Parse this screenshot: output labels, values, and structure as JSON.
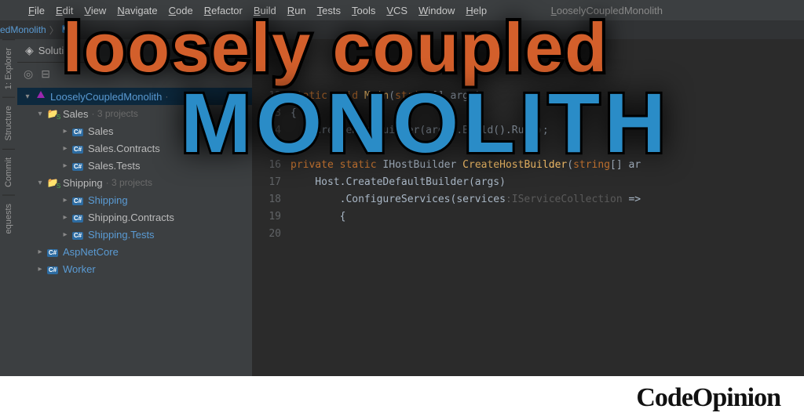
{
  "menubar": {
    "items": [
      "File",
      "Edit",
      "View",
      "Navigate",
      "Code",
      "Refactor",
      "Build",
      "Run",
      "Tests",
      "Tools",
      "VCS",
      "Window",
      "Help"
    ],
    "window_title": "LooselyCoupledMonolith"
  },
  "breadcrumb": {
    "root": "edMonolith",
    "badge": "C#"
  },
  "left_tools": [
    "1: Explorer",
    "Structure",
    "Commit",
    "equests"
  ],
  "explorer": {
    "header": "Soluti",
    "tree": {
      "solution": "LooselyCoupledMonolith",
      "groups": [
        {
          "name": "Sales",
          "meta": "· 3 projects",
          "projects": [
            "Sales",
            "Sales.Contracts",
            "Sales.Tests"
          ],
          "links": [
            false,
            false,
            false
          ]
        },
        {
          "name": "Shipping",
          "meta": "· 3 projects",
          "projects": [
            "Shipping",
            "Shipping.Contracts",
            "Shipping.Tests"
          ],
          "links": [
            true,
            false,
            true
          ]
        }
      ],
      "extra": [
        "AspNetCore",
        "Worker"
      ]
    }
  },
  "editor": {
    "lines_start": 12,
    "lines": [
      {
        "n": 12,
        "html": "<span class='kw'>static</span> <span class='kw'>void</span> <span class='mth'>Main</span>(<span class='kw'>string</span>[] args)"
      },
      {
        "n": 13,
        "html": "{"
      },
      {
        "n": 14,
        "html": "    CreateHostBuilder(args).Build().Run();"
      },
      {
        "n": 15,
        "html": "}"
      },
      {
        "n": 16,
        "html": ""
      },
      {
        "n": 17,
        "html": "<span class='kw'>private</span> <span class='kw'>static</span> IHostBuilder <span class='mth'>CreateHostBuilder</span>(<span class='kw'>string</span>[] ar"
      },
      {
        "n": 18,
        "html": "    Host.CreateDefaultBuilder(args)"
      },
      {
        "n": 19,
        "html": "        .ConfigureServices(services<span class='hint'>:IServiceCollection</span>  =>"
      },
      {
        "n": 20,
        "html": "        {"
      }
    ]
  },
  "overlay": {
    "line1": "loosely coupled",
    "line2": "MONOLITH"
  },
  "footer": {
    "brand": "CodeOpinion"
  }
}
